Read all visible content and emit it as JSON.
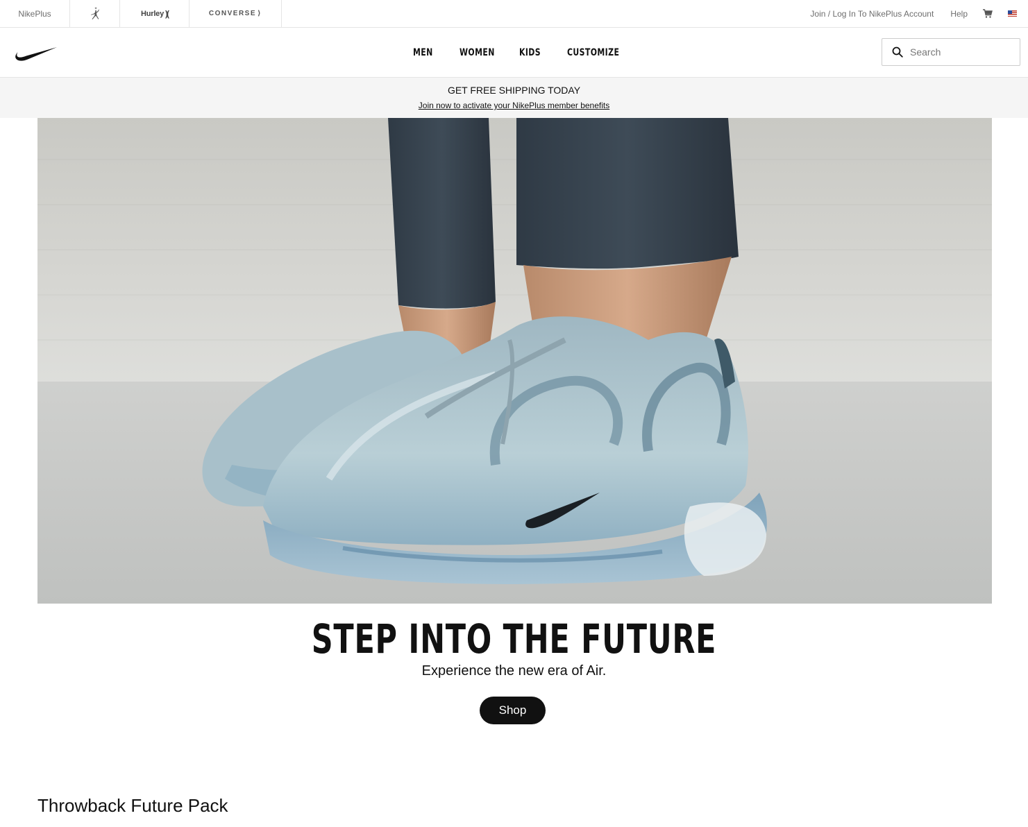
{
  "brand_bar": {
    "tabs": [
      {
        "label": "NikePlus",
        "icon": "nikeplus-text"
      },
      {
        "label": "",
        "icon": "jordan-jumpman-icon"
      },
      {
        "label": "Hurley",
        "icon": "hurley-logo"
      },
      {
        "label": "CONVERSE",
        "icon": "converse-logo"
      }
    ],
    "hurley_mark": ")(",
    "converse_mark": "⟩",
    "account_link": "Join / Log In To NikePlus Account",
    "help_link": "Help",
    "cart_icon": "cart-icon",
    "flag_icon": "us-flag-icon"
  },
  "nav": {
    "logo": "nike-swoosh-logo",
    "items": [
      "MEN",
      "WOMEN",
      "KIDS",
      "CUSTOMIZE"
    ],
    "search": {
      "placeholder": "Search",
      "value": "",
      "icon": "search-icon"
    }
  },
  "promo": {
    "title": "GET FREE SHIPPING TODAY",
    "link": "Join now to activate your NikePlus member benefits"
  },
  "hero": {
    "image": "sneaker-hero-image",
    "headline": "STEP INTO THE FUTURE",
    "subtitle": "Experience the new era of Air.",
    "button": "Shop"
  },
  "section": {
    "title": "Throwback Future Pack"
  },
  "colors": {
    "text": "#111111",
    "muted": "#6d6d6d",
    "border": "#e5e5e5",
    "banner_bg": "#f5f5f5",
    "button_bg": "#111111",
    "button_text": "#ffffff"
  }
}
